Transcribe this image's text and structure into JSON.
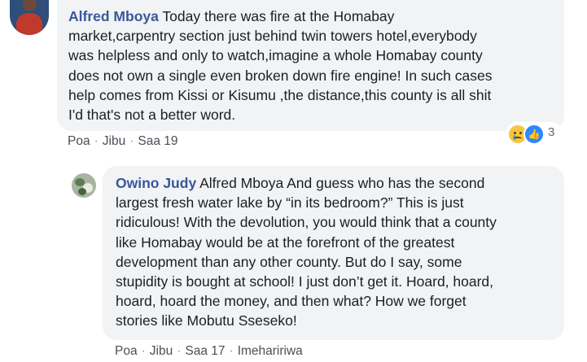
{
  "comments": [
    {
      "author": "Alfred Mboya",
      "text_lines": [
        "Today there was fire at the Homabay",
        "market,carpentry section just behind twin towers hotel,everybody",
        "was helpless and only to watch,imagine a whole Homabay county",
        "does not own a single even broken down fire engine! In such cases",
        "help comes from Kissi or Kisumu ,the distance,this county is all shit",
        "I'd that's not a better word."
      ],
      "actions": {
        "like": "Poa",
        "reply": "Jibu",
        "time": "Saa 19"
      },
      "reactions": {
        "icons": [
          "sad-emoji-icon",
          "like-icon"
        ],
        "count": "3"
      }
    },
    {
      "author": "Owino Judy",
      "text_lines": [
        "Alfred Mboya And guess who has the second",
        "largest fresh water lake by “in its bedroom?” This is just",
        "ridiculous! With the devolution, you would think that a county",
        "like Homabay would be at the forefront of the greatest",
        "development than any other county. But do I say, some",
        "stupidity is bought at school! I just don’t get it. Hoard, hoard,",
        "hoard, hoard the money, and then what? How we forget",
        "stories like Mobutu Sseseko!"
      ],
      "actions": {
        "like": "Poa",
        "reply": "Jibu",
        "time": "Saa 17",
        "edited": "Imehaririwa"
      }
    }
  ],
  "colors": {
    "author": "#385898",
    "bubble": "#f2f3f5",
    "meta": "#4b4f56"
  }
}
